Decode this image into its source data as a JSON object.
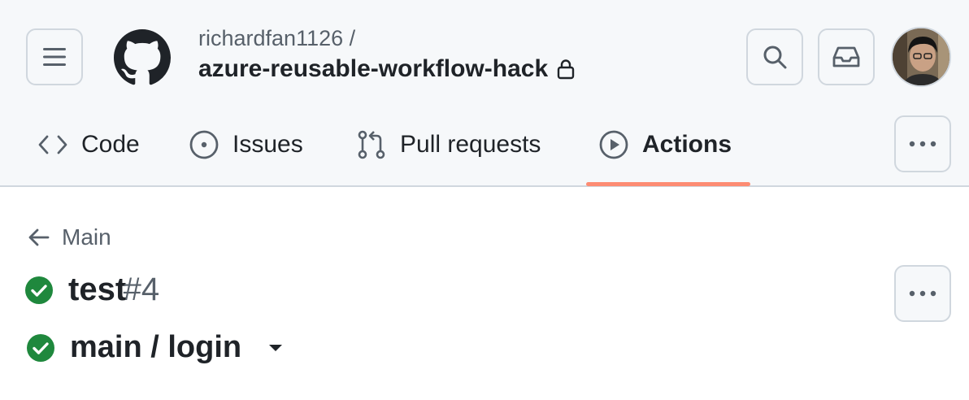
{
  "repo": {
    "owner": "richardfan1126 /",
    "name": "azure-reusable-workflow-hack",
    "visibility_icon": "lock-icon"
  },
  "header_buttons": {
    "menu_icon": "hamburger-icon",
    "search_icon": "search-icon",
    "inbox_icon": "inbox-icon"
  },
  "tabs": [
    {
      "label": "Code",
      "icon": "code-icon"
    },
    {
      "label": "Issues",
      "icon": "issue-opened-icon"
    },
    {
      "label": "Pull requests",
      "icon": "git-pull-request-icon"
    },
    {
      "label": "Actions",
      "icon": "play-icon",
      "selected": true
    }
  ],
  "back": {
    "label": "Main"
  },
  "run": {
    "name": "test",
    "number": "#4",
    "status": "success"
  },
  "job": {
    "name": "main / login",
    "status": "success"
  },
  "colors": {
    "success": "#1f883d",
    "accent_underline": "#fd8c73",
    "header_bg": "#f6f8fa",
    "border": "#d0d7de",
    "muted_text": "#57606a",
    "text": "#1f2328"
  }
}
